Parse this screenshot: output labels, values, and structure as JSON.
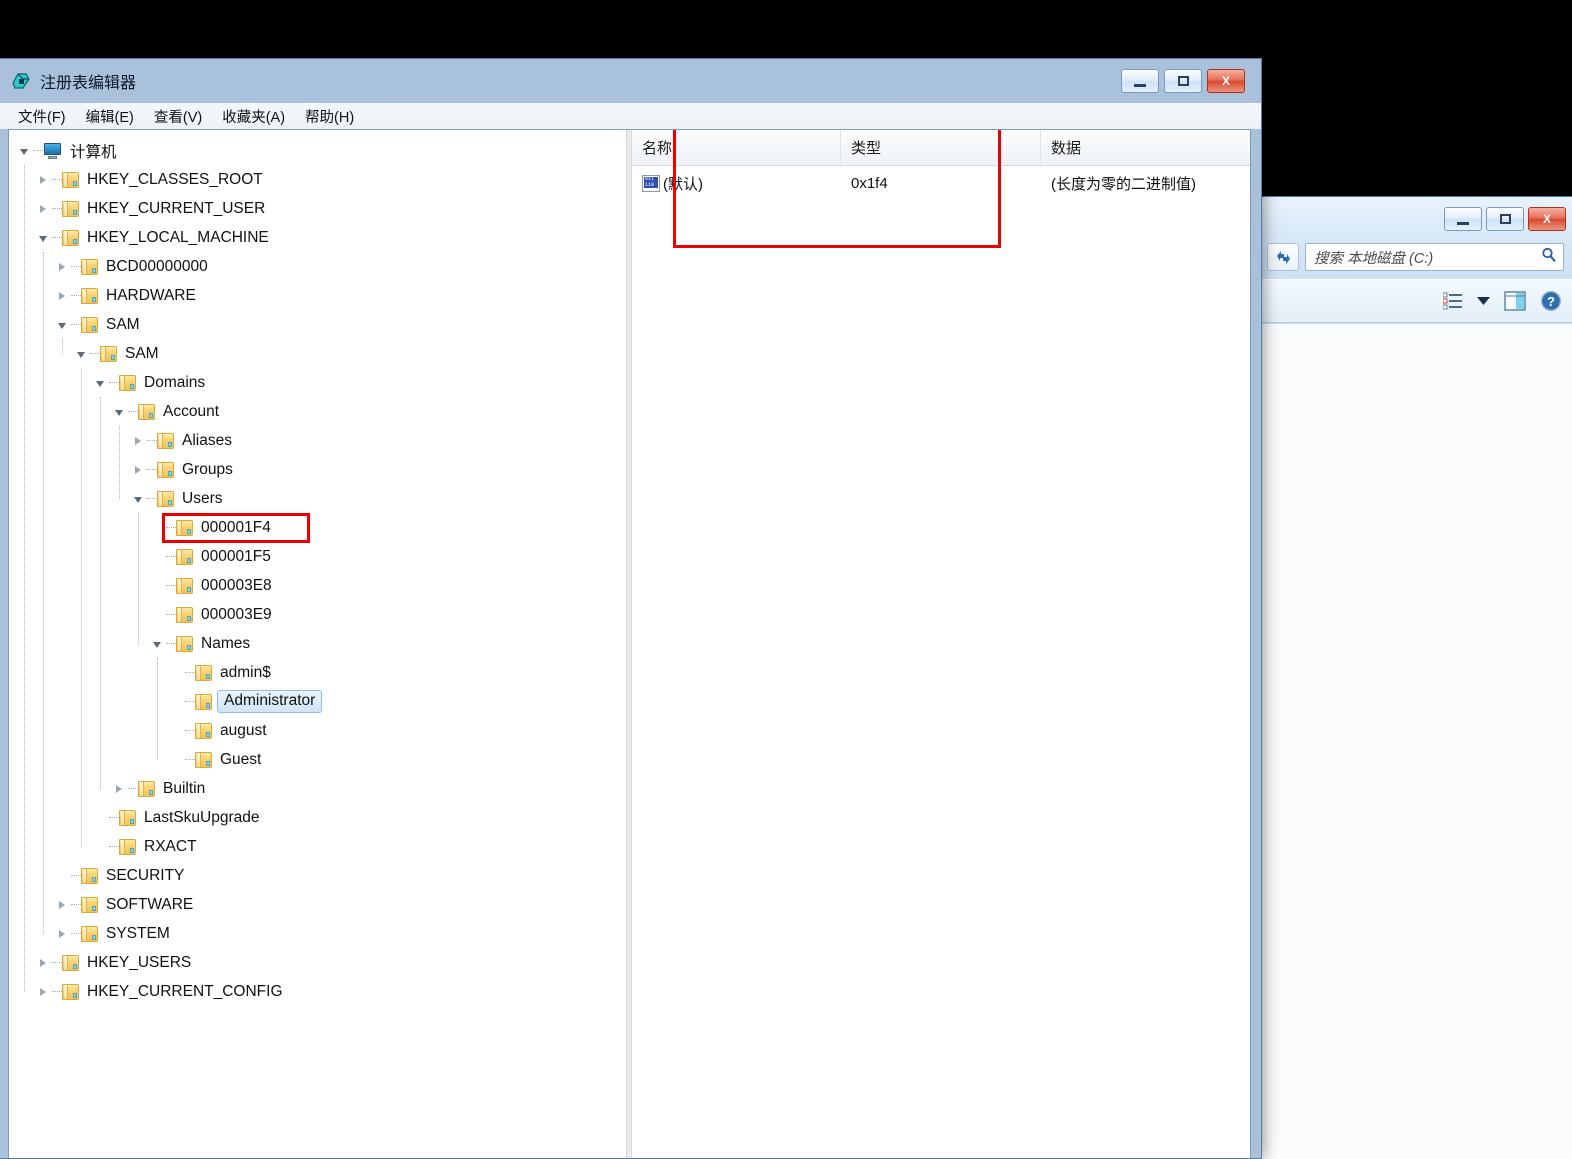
{
  "explorer": {
    "search_placeholder": "搜索 本地磁盘 (C:)",
    "refresh_icon": "refresh-icon",
    "search_icon": "magnifier-icon",
    "minimize_label": "",
    "maximize_label": "",
    "close_label": "X",
    "toolbar_icons": [
      "view-options-icon",
      "chevron-down-icon",
      "preview-pane-icon",
      "help-icon"
    ]
  },
  "regedit": {
    "title": "注册表编辑器",
    "app_icon": "regedit-icon",
    "window_buttons": {
      "minimize": "",
      "maximize": "",
      "close": "X"
    },
    "menu": [
      {
        "label": "文件(F)",
        "name": "menu-file"
      },
      {
        "label": "编辑(E)",
        "name": "menu-edit"
      },
      {
        "label": "查看(V)",
        "name": "menu-view"
      },
      {
        "label": "收藏夹(A)",
        "name": "menu-favorites"
      },
      {
        "label": "帮助(H)",
        "name": "menu-help"
      }
    ],
    "tree": [
      {
        "label": "计算机",
        "depth": 0,
        "state": "expanded",
        "icon": "computer-icon",
        "selected": false,
        "highlight": false
      },
      {
        "label": "HKEY_CLASSES_ROOT",
        "depth": 1,
        "state": "collapsed",
        "icon": "folder-icon",
        "selected": false,
        "highlight": false
      },
      {
        "label": "HKEY_CURRENT_USER",
        "depth": 1,
        "state": "collapsed",
        "icon": "folder-icon",
        "selected": false,
        "highlight": false
      },
      {
        "label": "HKEY_LOCAL_MACHINE",
        "depth": 1,
        "state": "expanded",
        "icon": "folder-icon",
        "selected": false,
        "highlight": false
      },
      {
        "label": "BCD00000000",
        "depth": 2,
        "state": "collapsed",
        "icon": "folder-icon",
        "selected": false,
        "highlight": false
      },
      {
        "label": "HARDWARE",
        "depth": 2,
        "state": "collapsed",
        "icon": "folder-icon",
        "selected": false,
        "highlight": false
      },
      {
        "label": "SAM",
        "depth": 2,
        "state": "expanded",
        "icon": "folder-icon",
        "selected": false,
        "highlight": false
      },
      {
        "label": "SAM",
        "depth": 3,
        "state": "expanded",
        "icon": "folder-icon",
        "selected": false,
        "highlight": false
      },
      {
        "label": "Domains",
        "depth": 4,
        "state": "expanded",
        "icon": "folder-icon",
        "selected": false,
        "highlight": false
      },
      {
        "label": "Account",
        "depth": 5,
        "state": "expanded",
        "icon": "folder-icon",
        "selected": false,
        "highlight": false
      },
      {
        "label": "Aliases",
        "depth": 6,
        "state": "collapsed",
        "icon": "folder-icon",
        "selected": false,
        "highlight": false
      },
      {
        "label": "Groups",
        "depth": 6,
        "state": "collapsed",
        "icon": "folder-icon",
        "selected": false,
        "highlight": false
      },
      {
        "label": "Users",
        "depth": 6,
        "state": "expanded",
        "icon": "folder-icon",
        "selected": false,
        "highlight": false
      },
      {
        "label": "000001F4",
        "depth": 7,
        "state": "leaf",
        "icon": "folder-icon",
        "selected": false,
        "highlight": true
      },
      {
        "label": "000001F5",
        "depth": 7,
        "state": "leaf",
        "icon": "folder-icon",
        "selected": false,
        "highlight": false
      },
      {
        "label": "000003E8",
        "depth": 7,
        "state": "leaf",
        "icon": "folder-icon",
        "selected": false,
        "highlight": false
      },
      {
        "label": "000003E9",
        "depth": 7,
        "state": "leaf",
        "icon": "folder-icon",
        "selected": false,
        "highlight": false
      },
      {
        "label": "Names",
        "depth": 7,
        "state": "expanded",
        "icon": "folder-icon",
        "selected": false,
        "highlight": false
      },
      {
        "label": "admin$",
        "depth": 8,
        "state": "leaf",
        "icon": "folder-icon",
        "selected": false,
        "highlight": false
      },
      {
        "label": "Administrator",
        "depth": 8,
        "state": "leaf",
        "icon": "folder-icon",
        "selected": true,
        "highlight": false
      },
      {
        "label": "august",
        "depth": 8,
        "state": "leaf",
        "icon": "folder-icon",
        "selected": false,
        "highlight": false
      },
      {
        "label": "Guest",
        "depth": 8,
        "state": "leaf",
        "icon": "folder-icon",
        "selected": false,
        "highlight": false
      },
      {
        "label": "Builtin",
        "depth": 5,
        "state": "collapsed",
        "icon": "folder-icon",
        "selected": false,
        "highlight": false
      },
      {
        "label": "LastSkuUpgrade",
        "depth": 4,
        "state": "leaf",
        "icon": "folder-icon",
        "selected": false,
        "highlight": false
      },
      {
        "label": "RXACT",
        "depth": 4,
        "state": "leaf",
        "icon": "folder-icon",
        "selected": false,
        "highlight": false
      },
      {
        "label": "SECURITY",
        "depth": 2,
        "state": "leaf",
        "icon": "folder-icon",
        "selected": false,
        "highlight": false
      },
      {
        "label": "SOFTWARE",
        "depth": 2,
        "state": "collapsed",
        "icon": "folder-icon",
        "selected": false,
        "highlight": false
      },
      {
        "label": "SYSTEM",
        "depth": 2,
        "state": "collapsed",
        "icon": "folder-icon",
        "selected": false,
        "highlight": false
      },
      {
        "label": "HKEY_USERS",
        "depth": 1,
        "state": "collapsed",
        "icon": "folder-icon",
        "selected": false,
        "highlight": false
      },
      {
        "label": "HKEY_CURRENT_CONFIG",
        "depth": 1,
        "state": "collapsed",
        "icon": "folder-icon",
        "selected": false,
        "highlight": false
      }
    ],
    "list": {
      "columns": [
        "名称",
        "类型",
        "数据"
      ],
      "rows": [
        {
          "name": "(默认)",
          "type": "0x1f4",
          "data": "(长度为零的二进制值)",
          "icon": "binary-value-icon"
        }
      ]
    },
    "annotations": {
      "accent_color": "#ee0000",
      "boxes": [
        "list-header-area",
        "tree-key-000001F4"
      ]
    }
  }
}
